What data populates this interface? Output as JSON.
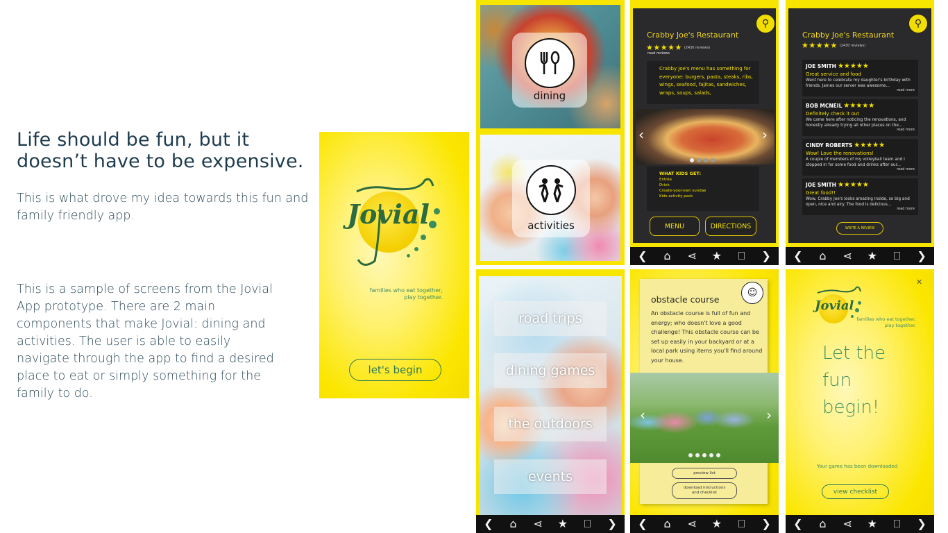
{
  "intro": {
    "title_line1": "Life should be fun, but it",
    "title_line2": "doesn’t have to be expensive.",
    "paragraph1": "This is what drove my idea towards this fun and family friendly app.",
    "paragraph2": "This is a sample of screens from the Jovial App prototype. There are 2 main components that make Jovial: dining and activities. The user is able to easily navigate through the app to find a desired place to eat or simply something for the family to do."
  },
  "splash": {
    "logo_text": "Jovial",
    "tagline_line1": "families who eat together,",
    "tagline_line2": "play together.",
    "begin_button": "let's begin"
  },
  "choice": {
    "dining_label": "dining",
    "activities_label": "activities"
  },
  "nav": {
    "back": "❮",
    "home": "⌂",
    "share": "⋖",
    "favorite": "★",
    "bookmark": "⎕",
    "forward": "❯"
  },
  "restaurant": {
    "name": "Crabby Joe's Restaurant",
    "stars": "★★★★★",
    "review_count": "(2430 reviews)",
    "read_reviews": "read reviews",
    "description": "Crabby Joe's menu has something for everyone: burgers, pasta, steaks, ribs, wings, seafood, fajitas, sandwiches, wraps, soups, salads,",
    "kids_heading": "WHAT KIDS GET:",
    "kids_items": [
      "Entrée",
      "Drink",
      "Create-your-own sundae",
      "Kids activity pack"
    ],
    "menu_button": "MENU",
    "directions_button": "DIRECTIONS"
  },
  "reviews": {
    "name": "Crabby Joe's Restaurant",
    "stars": "★★★★★",
    "review_count": "(2430 reviews)",
    "items": [
      {
        "name": "JOE SMITH",
        "stars": "★★★★★",
        "headline": "Great service and food",
        "body": "Went here to celebrate my daughter's birthday with friends. James our server was awesome...",
        "more": "read more"
      },
      {
        "name": "BOB MCNEIL",
        "stars": "★★★★★",
        "headline": "Definitely check it out",
        "body": "We came here after noticing the renovations, and honestly already trying all other places on the...",
        "more": "read more"
      },
      {
        "name": "CINDY ROBERTS",
        "stars": "★★★★★",
        "headline": "Wow! Love the renovations!",
        "body": "A couple of members of my volleyball team and I stopped in for some food and drinks after our...",
        "more": "read more"
      },
      {
        "name": "JOE SMITH",
        "stars": "★★★★★",
        "headline": "Great food!!",
        "body": "Wow, Crabby Joe's looks amazing inside, so big and open, nice and airy. The food is delicious...",
        "more": "read more"
      }
    ],
    "write_review": "WRITE A REVIEW"
  },
  "activity_menu": {
    "items": [
      "road trips",
      "dining games",
      "the outdoors",
      "events"
    ]
  },
  "obstacle": {
    "title": "obstacle course",
    "text": "An obstacle course is full of fun and energy; who doesn't love a good challenge! This obstacle course can be set up easily in your backyard or at a local park using items you'll find around your house.",
    "preview_button": "preview list",
    "download_button_line1": "download instructions",
    "download_button_line2": "and checklist"
  },
  "final": {
    "close": "✕",
    "logo_text": "Jovial",
    "tagline_line1": "families who eat together,",
    "tagline_line2": "play together.",
    "headline_line1": "Let the",
    "headline_line2": "fun",
    "headline_line3": "begin!",
    "note": "Your game has been downloaded",
    "checklist_button": "view checklist"
  },
  "colors": {
    "brand_yellow": "#f7e500",
    "brand_green": "#3e8f5d",
    "dark_panel": "#2a2a2c"
  }
}
